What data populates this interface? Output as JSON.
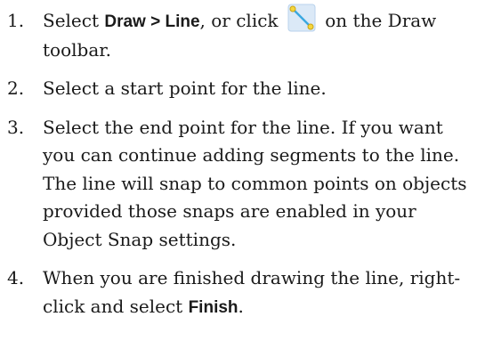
{
  "steps": [
    {
      "number": "1.",
      "text_before": "Select ",
      "ui_label": "Draw > Line",
      "text_middle": ", or click ",
      "icon": "draw-line-tool-icon",
      "text_after": " on the Draw toolbar."
    },
    {
      "number": "2.",
      "text": "Select a start point for the line."
    },
    {
      "number": "3.",
      "text": "Select the end point for the line. If you want you can continue adding segments to the line. The line will snap to common points on objects provided those snaps are enabled in your Object Snap settings."
    },
    {
      "number": "4.",
      "text_before": "When you are finished drawing the line, right-click and select ",
      "ui_label": "Finish",
      "text_after": "."
    }
  ],
  "colors": {
    "text": "#1a1a1a",
    "icon_line": "#3aa8e0",
    "icon_endpoint": "#f5d53d",
    "icon_bg": "#dbe9f7"
  }
}
